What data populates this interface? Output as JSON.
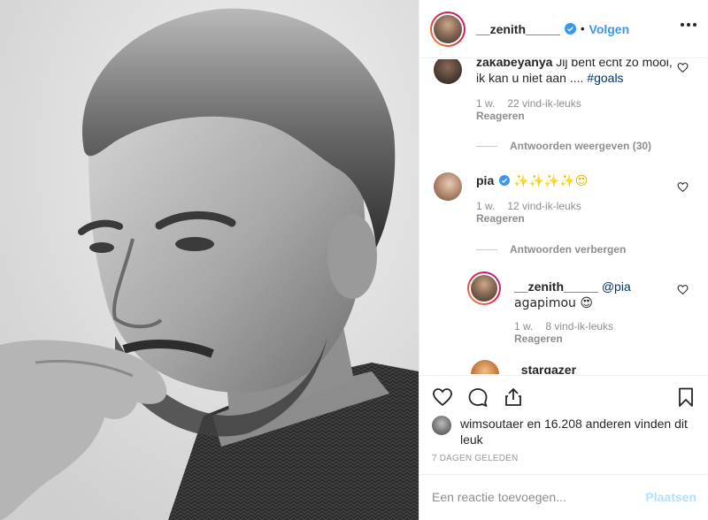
{
  "header": {
    "username": "__zenith_____",
    "separator": "•",
    "follow_label": "Volgen"
  },
  "comments": [
    {
      "username": "zakabeyanya",
      "text": "Jij bent echt zo mooi, ik kan u niet aan ....",
      "hashtag": "#goals",
      "time": "1 w.",
      "likes": "22 vind-ik-leuks",
      "reply": "Reageren",
      "thread_label": "Antwoorden weergeven (30)"
    },
    {
      "username": "pia",
      "text": "✨✨✨✨😍",
      "time": "1 w.",
      "likes": "12 vind-ik-leuks",
      "reply": "Reageren",
      "thread_label": "Antwoorden verbergen",
      "replies": [
        {
          "username": "__zenith_____",
          "mention": "@pia",
          "text": "agapimou 😍",
          "time": "1 w.",
          "likes": "8 vind-ik-leuks",
          "reply": "Reageren"
        }
      ]
    },
    {
      "username": "_stargazer"
    }
  ],
  "likes": {
    "user": "wimsoutaer",
    "rest": "en 16.208 anderen vinden dit leuk"
  },
  "date": "7 DAGEN GELEDEN",
  "add_comment": {
    "placeholder": "Een reactie toevoegen...",
    "post_label": "Plaatsen"
  },
  "icons": {
    "verified": "verified-badge-icon",
    "like": "heart-icon",
    "comment": "comment-icon",
    "share": "share-icon",
    "save": "bookmark-icon",
    "more": "more-options-icon"
  },
  "colors": {
    "accent": "#3897f0",
    "link": "#003569",
    "muted": "#8e8e8e",
    "post_disabled": "#b2dffc"
  }
}
